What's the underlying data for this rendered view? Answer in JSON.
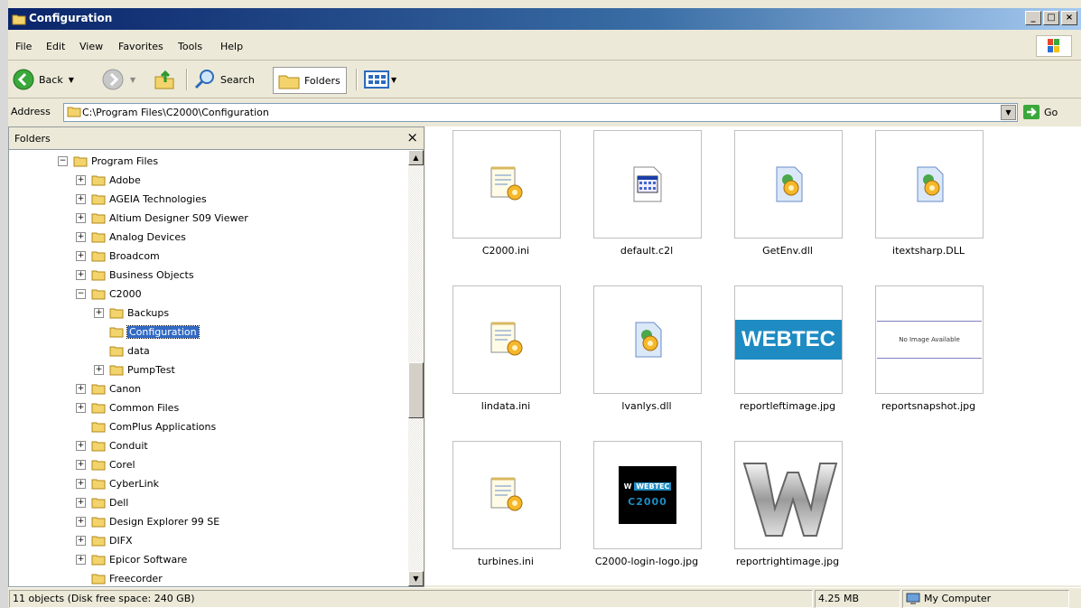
{
  "window": {
    "title": "Configuration"
  },
  "menu": [
    "File",
    "Edit",
    "View",
    "Favorites",
    "Tools",
    "Help"
  ],
  "toolbar": {
    "back_label": "Back",
    "search_label": "Search",
    "folders_label": "Folders"
  },
  "address": {
    "label": "Address",
    "path": "C:\\Program Files\\C2000\\Configuration",
    "go_label": "Go"
  },
  "folders_pane": {
    "title": "Folders",
    "tree": [
      {
        "label": "Program Files",
        "expander": "minus",
        "depth": 0
      },
      {
        "label": "Adobe",
        "expander": "plus",
        "depth": 1
      },
      {
        "label": "AGEIA Technologies",
        "expander": "plus",
        "depth": 1
      },
      {
        "label": "Altium Designer S09 Viewer",
        "expander": "plus",
        "depth": 1
      },
      {
        "label": "Analog Devices",
        "expander": "plus",
        "depth": 1
      },
      {
        "label": "Broadcom",
        "expander": "plus",
        "depth": 1
      },
      {
        "label": "Business Objects",
        "expander": "plus",
        "depth": 1
      },
      {
        "label": "C2000",
        "expander": "minus",
        "depth": 1
      },
      {
        "label": "Backups",
        "expander": "plus",
        "depth": 2
      },
      {
        "label": "Configuration",
        "expander": "none",
        "depth": 2,
        "selected": true
      },
      {
        "label": "data",
        "expander": "none",
        "depth": 2
      },
      {
        "label": "PumpTest",
        "expander": "plus",
        "depth": 2
      },
      {
        "label": "Canon",
        "expander": "plus",
        "depth": 1
      },
      {
        "label": "Common Files",
        "expander": "plus",
        "depth": 1
      },
      {
        "label": "ComPlus Applications",
        "expander": "none",
        "depth": 1
      },
      {
        "label": "Conduit",
        "expander": "plus",
        "depth": 1
      },
      {
        "label": "Corel",
        "expander": "plus",
        "depth": 1
      },
      {
        "label": "CyberLink",
        "expander": "plus",
        "depth": 1
      },
      {
        "label": "Dell",
        "expander": "plus",
        "depth": 1
      },
      {
        "label": "Design Explorer 99 SE",
        "expander": "plus",
        "depth": 1
      },
      {
        "label": "DIFX",
        "expander": "plus",
        "depth": 1
      },
      {
        "label": "Epicor Software",
        "expander": "plus",
        "depth": 1
      },
      {
        "label": "Freecorder",
        "expander": "none",
        "depth": 1
      }
    ]
  },
  "files": [
    {
      "name": "C2000.ini",
      "icon": "ini-settings-icon"
    },
    {
      "name": "default.c2l",
      "icon": "c2l-file-icon"
    },
    {
      "name": "GetEnv.dll",
      "icon": "dll-file-icon"
    },
    {
      "name": "itextsharp.DLL",
      "icon": "dll-file-icon"
    },
    {
      "name": "lindata.ini",
      "icon": "ini-settings-icon"
    },
    {
      "name": "lvanlys.dll",
      "icon": "dll-file-icon"
    },
    {
      "name": "reportleftimage.jpg",
      "icon": "webtec-thumbnail",
      "thumb_text": "WEBTEC"
    },
    {
      "name": "reportsnapshot.jpg",
      "icon": "no-image-thumbnail",
      "thumb_text": "No Image Available"
    },
    {
      "name": "turbines.ini",
      "icon": "ini-settings-icon"
    },
    {
      "name": "C2000-login-logo.jpg",
      "icon": "c2000-logo-thumbnail",
      "thumb_text": "WEBTEC C2000"
    },
    {
      "name": "reportrightimage.jpg",
      "icon": "chrome-w-thumbnail"
    }
  ],
  "status": {
    "objects": "11 objects (Disk free space: 240 GB)",
    "size": "4.25 MB",
    "location": "My Computer"
  },
  "colors": {
    "titlebar": "#0a246a",
    "selection": "#316ac5",
    "folder": "#f3d36b",
    "webtec": "#1e8bc3"
  }
}
